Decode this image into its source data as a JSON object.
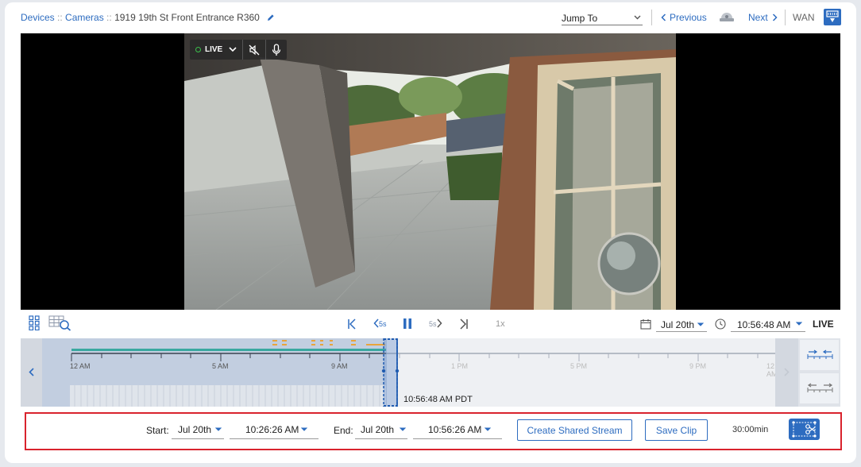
{
  "breadcrumb": {
    "devices": "Devices",
    "sep1": " :: ",
    "cameras": "Cameras",
    "sep2": " :: ",
    "camera_name": "1919 19th St Front Entrance R360"
  },
  "nav": {
    "jump_to": "Jump To",
    "previous": "Previous",
    "next": "Next",
    "network": "WAN"
  },
  "player": {
    "live_label": "LIVE",
    "speed": "1x",
    "date": "Jul 20th",
    "time": "10:56:48 AM",
    "live_status": "LIVE",
    "back_skip": "5s",
    "fwd_skip": "5s"
  },
  "timeline": {
    "ticks": [
      "12 AM",
      "5 AM",
      "9 AM",
      "1 PM",
      "5 PM",
      "9 PM",
      "12 AM"
    ],
    "current_time": "10:56:48 AM PDT",
    "playhead_fraction": 0.4587
  },
  "clip": {
    "start_label": "Start:",
    "start_date": "Jul 20th",
    "start_time": "10:26:26 AM",
    "end_label": "End:",
    "end_date": "Jul 20th",
    "end_time": "10:56:26 AM",
    "create_stream": "Create Shared Stream",
    "save_clip": "Save Clip",
    "duration": "30:00min"
  },
  "colors": {
    "accent": "#2d6cc0",
    "highlight_border": "#d9232d",
    "motion_bar": "#3aa8a0",
    "event_marks": "#e8a43c"
  }
}
